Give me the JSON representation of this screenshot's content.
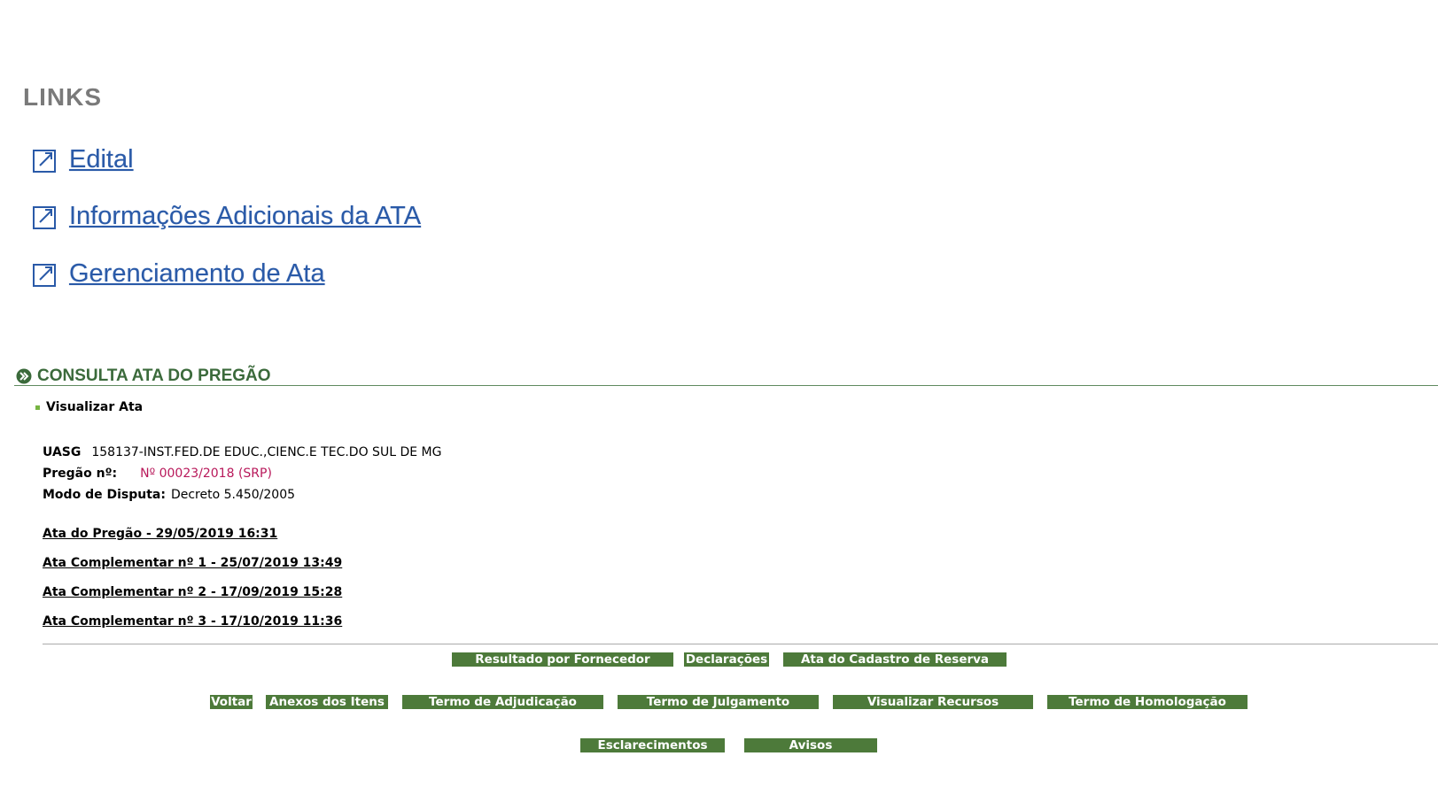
{
  "links": {
    "title": "LINKS",
    "items": [
      {
        "label": " Edital"
      },
      {
        "label": " Informações Adicionais da ATA"
      },
      {
        "label": " Gerenciamento de Ata"
      }
    ]
  },
  "section": {
    "title": "CONSULTA ATA DO PREGÃO",
    "subtitle": "Visualizar Ata"
  },
  "info": {
    "uasg_label": "UASG",
    "uasg_value": "158137-INST.FED.DE EDUC.,CIENC.E TEC.DO SUL DE MG",
    "pregao_label": "Pregão nº:",
    "pregao_value": "Nº 00023/2018 (SRP)",
    "modo_label": "Modo de Disputa:",
    "modo_value": "Decreto 5.450/2005"
  },
  "atas": [
    "Ata do Pregão - 29/05/2019 16:31",
    "Ata Complementar nº 1 - 25/07/2019 13:49",
    "Ata Complementar nº 2 - 17/09/2019 15:28",
    "Ata Complementar nº 3 - 17/10/2019 11:36"
  ],
  "buttons": {
    "row1": [
      "Resultado por Fornecedor",
      "Declarações",
      "Ata do Cadastro de Reserva"
    ],
    "row2": [
      "Voltar",
      "Anexos dos Itens",
      "Termo de Adjudicação",
      "Termo de Julgamento",
      "Visualizar Recursos",
      "Termo de Homologação"
    ],
    "row3": [
      "Esclarecimentos",
      "Avisos"
    ]
  },
  "colors": {
    "link_blue": "#2a5aa8",
    "button_green": "#4d7a3a",
    "section_green": "#3b6a3b",
    "pregao_red": "#b8185a"
  }
}
